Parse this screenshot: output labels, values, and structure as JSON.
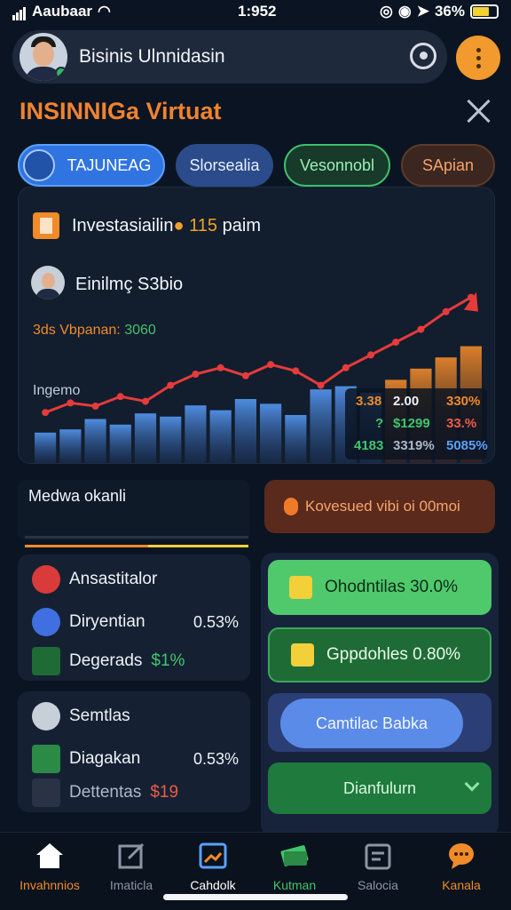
{
  "status_bar": {
    "carrier": "Aaubaar",
    "time": "1:952",
    "battery": "36%"
  },
  "header": {
    "title": "Bisinis Ulnnidasin"
  },
  "page_title": "INSINNIGa Virtuat",
  "tabs": [
    "TAJUNEAG",
    "Slorsealia",
    "Vesonnobl",
    "SApian"
  ],
  "chart_card": {
    "title": "Investasiailin",
    "badge_value": "115",
    "badge_unit": "paim",
    "subtitle": "Einilmç S3bio",
    "note_orange": "3ds Vbpanan:",
    "note_green": "3060",
    "y_label": "Ingemo",
    "stats": [
      [
        "3.38",
        "2.00",
        "330%"
      ],
      [
        "?",
        "$1299",
        "33.%"
      ],
      [
        "4183",
        "3319%",
        "5085%"
      ]
    ]
  },
  "chart_data": {
    "type": "bar",
    "title": "",
    "values": [
      38,
      42,
      55,
      48,
      62,
      58,
      72,
      66,
      80,
      74,
      60,
      92,
      96,
      88,
      104,
      118,
      132,
      146
    ],
    "line_values": [
      52,
      64,
      60,
      72,
      66,
      86,
      100,
      108,
      98,
      112,
      104,
      86,
      108,
      124,
      140,
      156,
      178,
      196
    ]
  },
  "section": {
    "title": "Medwa okanli",
    "cta": "Kovesued vibi oi 00moi"
  },
  "info_card_1": {
    "title": "Ansastitalor",
    "rows": [
      {
        "label": "Diryentian",
        "value": "0.53%"
      },
      {
        "label": "Degerads",
        "value": "$1%"
      }
    ]
  },
  "info_card_2": {
    "title": "Semtlas",
    "rows": [
      {
        "label": "Diagakan",
        "value": "0.53%"
      },
      {
        "label": "Dettentas",
        "value": "$19"
      }
    ]
  },
  "right_buttons": {
    "b1": "Ohodntilas 30.0%",
    "b2": "Gppdohles 0.80%",
    "b3": "Camtilac Babka",
    "b4": "Dianfulurn"
  },
  "bottom_nav": [
    {
      "label": "Invahnnios",
      "color": "#f08b2a"
    },
    {
      "label": "Imaticla",
      "color": "#8b95a4"
    },
    {
      "label": "Cahdolk",
      "color": "#ffffff"
    },
    {
      "label": "Kutman",
      "color": "#41c56b"
    },
    {
      "label": "Salocia",
      "color": "#8b95a4"
    },
    {
      "label": "Kanala",
      "color": "#f08b2a"
    }
  ]
}
